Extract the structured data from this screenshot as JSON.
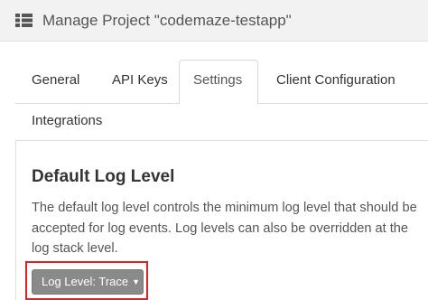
{
  "header": {
    "icon": "list-icon",
    "title": "Manage Project \"codemaze-testapp\""
  },
  "tabs": {
    "general": "General",
    "api_keys": "API Keys",
    "settings": "Settings",
    "client_configuration": "Client Configuration",
    "integrations": "Integrations",
    "active": "Settings"
  },
  "section": {
    "title": "Default Log Level",
    "description": "The default log level controls the minimum log level that should be accepted for log events. Log levels can also be overridden at the log stack level."
  },
  "log_level_button": {
    "label": "Log Level: Trace",
    "caret_icon": "caret-down-icon"
  },
  "colors": {
    "highlight": "#e02020",
    "button_bg": "#8a8a8a",
    "header_bg": "#f2f2f2"
  }
}
